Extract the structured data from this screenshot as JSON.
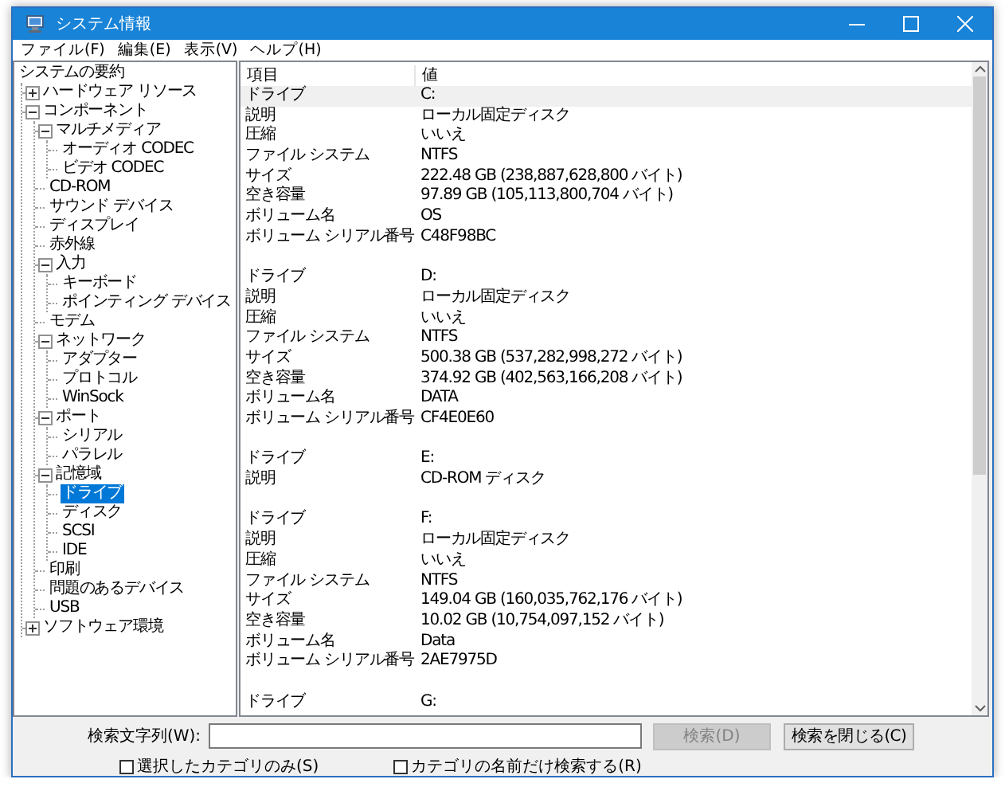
{
  "window": {
    "title": "システム情報"
  },
  "menu": [
    "ファイル(F)",
    "編集(E)",
    "表示(V)",
    "ヘルプ(H)"
  ],
  "tree": [
    {
      "label": "システムの要約",
      "selected": false,
      "children": [
        {
          "label": "ハードウェア リソース",
          "selected": false,
          "expanded": false
        },
        {
          "label": "コンポーネント",
          "selected": false,
          "expanded": true,
          "children": [
            {
              "label": "マルチメディア",
              "selected": false,
              "expanded": true,
              "children": [
                {
                  "label": "オーディオ CODEC",
                  "selected": false
                },
                {
                  "label": "ビデオ CODEC",
                  "selected": false
                }
              ]
            },
            {
              "label": "CD-ROM",
              "selected": false
            },
            {
              "label": "サウンド デバイス",
              "selected": false
            },
            {
              "label": "ディスプレイ",
              "selected": false
            },
            {
              "label": "赤外線",
              "selected": false
            },
            {
              "label": "入力",
              "selected": false,
              "expanded": true,
              "children": [
                {
                  "label": "キーボード",
                  "selected": false
                },
                {
                  "label": "ポインティング デバイス",
                  "selected": false
                }
              ]
            },
            {
              "label": "モデム",
              "selected": false
            },
            {
              "label": "ネットワーク",
              "selected": false,
              "expanded": true,
              "children": [
                {
                  "label": "アダプター",
                  "selected": false
                },
                {
                  "label": "プロトコル",
                  "selected": false
                },
                {
                  "label": "WinSock",
                  "selected": false
                }
              ]
            },
            {
              "label": "ポート",
              "selected": false,
              "expanded": true,
              "children": [
                {
                  "label": "シリアル",
                  "selected": false
                },
                {
                  "label": "パラレル",
                  "selected": false
                }
              ]
            },
            {
              "label": "記憶域",
              "selected": false,
              "expanded": true,
              "children": [
                {
                  "label": "ドライブ",
                  "selected": true
                },
                {
                  "label": "ディスク",
                  "selected": false
                },
                {
                  "label": "SCSI",
                  "selected": false
                },
                {
                  "label": "IDE",
                  "selected": false
                }
              ]
            },
            {
              "label": "印刷",
              "selected": false
            },
            {
              "label": "問題のあるデバイス",
              "selected": false
            },
            {
              "label": "USB",
              "selected": false
            }
          ]
        },
        {
          "label": "ソフトウェア環境",
          "selected": false,
          "expanded": false
        }
      ]
    }
  ],
  "table": {
    "columns": [
      "項目",
      "値"
    ],
    "groups": [
      {
        "rows": [
          {
            "item": "ドライブ",
            "value": "C:",
            "selected": true
          },
          {
            "item": "説明",
            "value": "ローカル固定ディスク",
            "selected": false
          },
          {
            "item": "圧縮",
            "value": "いいえ",
            "selected": false
          },
          {
            "item": "ファイル システム",
            "value": "NTFS",
            "selected": false
          },
          {
            "item": "サイズ",
            "value": "222.48 GB (238,887,628,800 バイト)",
            "selected": false
          },
          {
            "item": "空き容量",
            "value": "97.89 GB (105,113,800,704 バイト)",
            "selected": false
          },
          {
            "item": "ボリューム名",
            "value": "OS",
            "selected": false
          },
          {
            "item": "ボリューム シリアル番号",
            "value": "C48F98BC",
            "selected": false
          }
        ]
      },
      {
        "rows": [
          {
            "item": "ドライブ",
            "value": "D:",
            "selected": false
          },
          {
            "item": "説明",
            "value": "ローカル固定ディスク",
            "selected": false
          },
          {
            "item": "圧縮",
            "value": "いいえ",
            "selected": false
          },
          {
            "item": "ファイル システム",
            "value": "NTFS",
            "selected": false
          },
          {
            "item": "サイズ",
            "value": "500.38 GB (537,282,998,272 バイト)",
            "selected": false
          },
          {
            "item": "空き容量",
            "value": "374.92 GB (402,563,166,208 バイト)",
            "selected": false
          },
          {
            "item": "ボリューム名",
            "value": "DATA",
            "selected": false
          },
          {
            "item": "ボリューム シリアル番号",
            "value": "CF4E0E60",
            "selected": false
          }
        ]
      },
      {
        "rows": [
          {
            "item": "ドライブ",
            "value": "E:",
            "selected": false
          },
          {
            "item": "説明",
            "value": "CD-ROM ディスク",
            "selected": false
          }
        ]
      },
      {
        "rows": [
          {
            "item": "ドライブ",
            "value": "F:",
            "selected": false
          },
          {
            "item": "説明",
            "value": "ローカル固定ディスク",
            "selected": false
          },
          {
            "item": "圧縮",
            "value": "いいえ",
            "selected": false
          },
          {
            "item": "ファイル システム",
            "value": "NTFS",
            "selected": false
          },
          {
            "item": "サイズ",
            "value": "149.04 GB (160,035,762,176 バイト)",
            "selected": false
          },
          {
            "item": "空き容量",
            "value": "10.02 GB (10,754,097,152 バイト)",
            "selected": false
          },
          {
            "item": "ボリューム名",
            "value": "Data",
            "selected": false
          },
          {
            "item": "ボリューム シリアル番号",
            "value": "2AE7975D",
            "selected": false
          }
        ]
      },
      {
        "rows": [
          {
            "item": "ドライブ",
            "value": "G:",
            "selected": false
          }
        ]
      }
    ]
  },
  "find": {
    "label": "検索文字列(W):",
    "search_button": {
      "label": "検索(D)",
      "disabled": true
    },
    "close_button": {
      "label": "検索を閉じる(C)",
      "disabled": false
    },
    "options": [
      {
        "label": "選択したカテゴリのみ(S)",
        "checked": false
      },
      {
        "label": "カテゴリの名前だけ検索する(R)",
        "checked": false
      }
    ]
  }
}
